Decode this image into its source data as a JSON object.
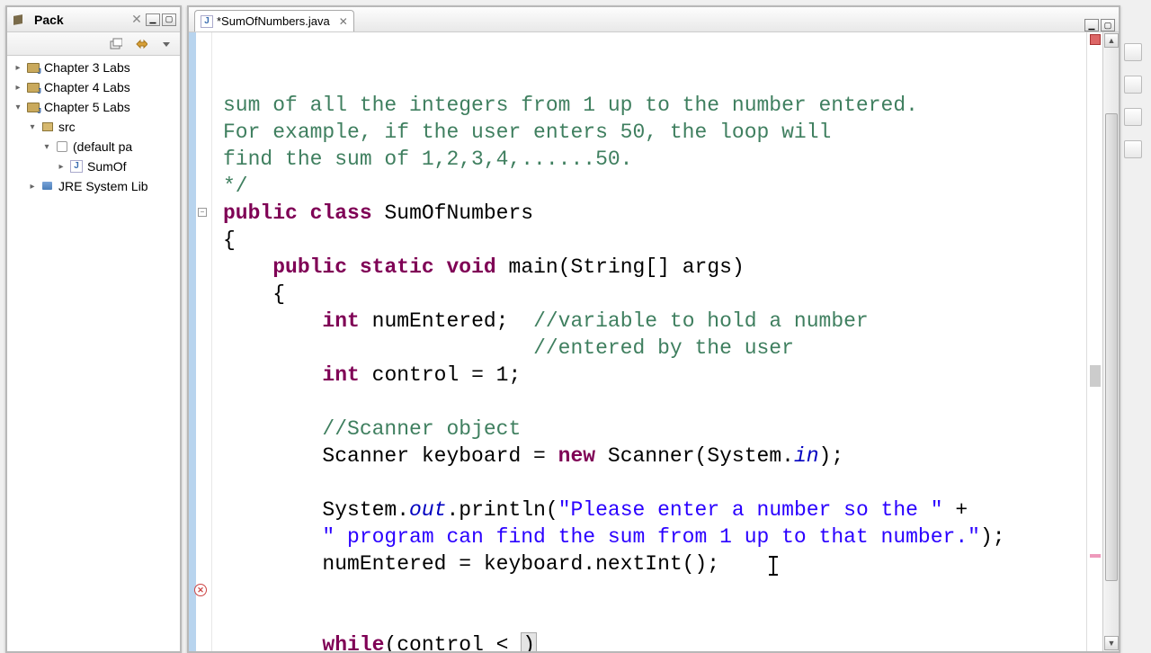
{
  "panel": {
    "title": "Pack",
    "tree": [
      {
        "label": "Chapter 3 Labs",
        "depth": 0,
        "exp": "▸",
        "icon": "proj-icon"
      },
      {
        "label": "Chapter 4 Labs",
        "depth": 0,
        "exp": "▸",
        "icon": "proj-icon"
      },
      {
        "label": "Chapter 5 Labs",
        "depth": 0,
        "exp": "▾",
        "icon": "proj-icon"
      },
      {
        "label": "src",
        "depth": 1,
        "exp": "▾",
        "icon": "src-icon"
      },
      {
        "label": "(default pa",
        "depth": 2,
        "exp": "▾",
        "icon": "pkg-icon"
      },
      {
        "label": "SumOf",
        "depth": 3,
        "exp": "▸",
        "icon": "java-icon"
      },
      {
        "label": "JRE System Lib",
        "depth": 1,
        "exp": "▸",
        "icon": "lib-icon"
      }
    ]
  },
  "editor": {
    "tab_label": "*SumOfNumbers.java",
    "code_tokens": [
      [
        {
          "t": "sum of all the integers from 1 up to the number entered.",
          "c": "cm"
        }
      ],
      [
        {
          "t": "For example, if the user enters 50, the loop will",
          "c": "cm"
        }
      ],
      [
        {
          "t": "find the sum of 1,2,3,4,......50.",
          "c": "cm"
        }
      ],
      [
        {
          "t": "*/",
          "c": "cm"
        }
      ],
      [
        {
          "t": "public",
          "c": "kw"
        },
        {
          "t": " "
        },
        {
          "t": "class",
          "c": "kw"
        },
        {
          "t": " SumOfNumbers"
        }
      ],
      [
        {
          "t": "{"
        }
      ],
      [
        {
          "t": "    "
        },
        {
          "t": "public",
          "c": "kw"
        },
        {
          "t": " "
        },
        {
          "t": "static",
          "c": "kw"
        },
        {
          "t": " "
        },
        {
          "t": "void",
          "c": "kw"
        },
        {
          "t": " main(String[] args)"
        }
      ],
      [
        {
          "t": "    {"
        }
      ],
      [
        {
          "t": "        "
        },
        {
          "t": "int",
          "c": "kw"
        },
        {
          "t": " numEntered;  "
        },
        {
          "t": "//variable to hold a number",
          "c": "cm"
        }
      ],
      [
        {
          "t": "                         "
        },
        {
          "t": "//entered by the user",
          "c": "cm"
        }
      ],
      [
        {
          "t": "        "
        },
        {
          "t": "int",
          "c": "kw"
        },
        {
          "t": " control = 1;"
        }
      ],
      [
        {
          "t": " "
        }
      ],
      [
        {
          "t": "        "
        },
        {
          "t": "//Scanner object",
          "c": "cm"
        }
      ],
      [
        {
          "t": "        Scanner keyboard = "
        },
        {
          "t": "new",
          "c": "kw"
        },
        {
          "t": " Scanner(System."
        },
        {
          "t": "in",
          "c": "fld"
        },
        {
          "t": ");"
        }
      ],
      [
        {
          "t": " "
        }
      ],
      [
        {
          "t": "        System."
        },
        {
          "t": "out",
          "c": "fld"
        },
        {
          "t": ".println("
        },
        {
          "t": "\"Please enter a number so the \"",
          "c": "str"
        },
        {
          "t": " +"
        }
      ],
      [
        {
          "t": "        "
        },
        {
          "t": "\" program can find the sum from 1 up to that number.\"",
          "c": "str"
        },
        {
          "t": ");"
        }
      ],
      [
        {
          "t": "        numEntered = keyboard.nextInt();"
        }
      ],
      [
        {
          "t": " "
        }
      ],
      [
        {
          "t": " "
        }
      ],
      [
        {
          "t": "        "
        },
        {
          "t": "while",
          "c": "kw"
        },
        {
          "t": "("
        },
        {
          "t": "control",
          "c": "err-underline"
        },
        {
          "t": " < "
        },
        {
          "t": ")",
          "c": "selbox",
          "cursor": true
        }
      ]
    ],
    "error_line_index": 20,
    "fold_line_index": 6
  }
}
